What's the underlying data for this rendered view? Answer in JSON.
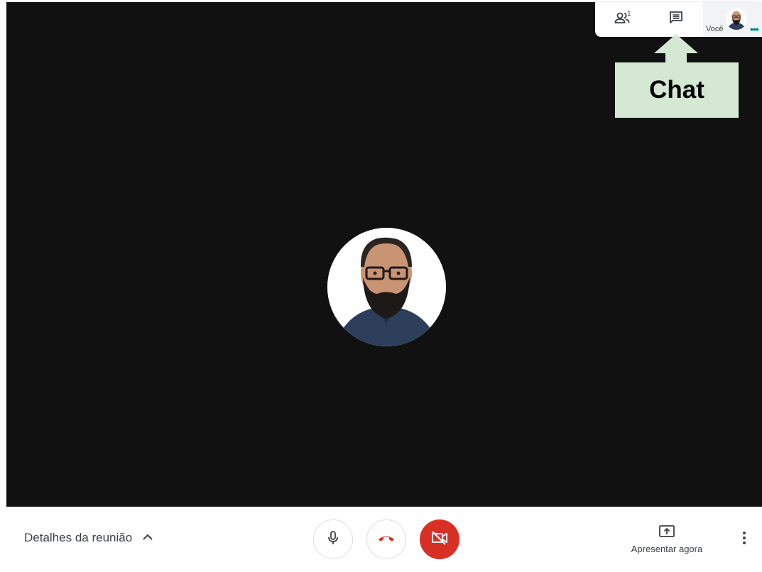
{
  "top_panel": {
    "people_count": "1",
    "people_icon": "people-icon",
    "chat_icon": "chat-icon",
    "you_label": "Você"
  },
  "callout": {
    "text": "Chat",
    "color": "#d5e8d4"
  },
  "bottom_bar": {
    "meeting_details_label": "Detalhes da reunião",
    "present_label": "Apresentar agora",
    "mic_icon": "microphone-icon",
    "hangup_icon": "hang-up-icon",
    "camera_icon": "camera-off-icon",
    "more_icon": "more-vertical-icon"
  },
  "colors": {
    "stage_background": "#111111",
    "camera_off_red": "#d93025",
    "hangup_red": "#d93025",
    "text_gray": "#3c4043"
  }
}
